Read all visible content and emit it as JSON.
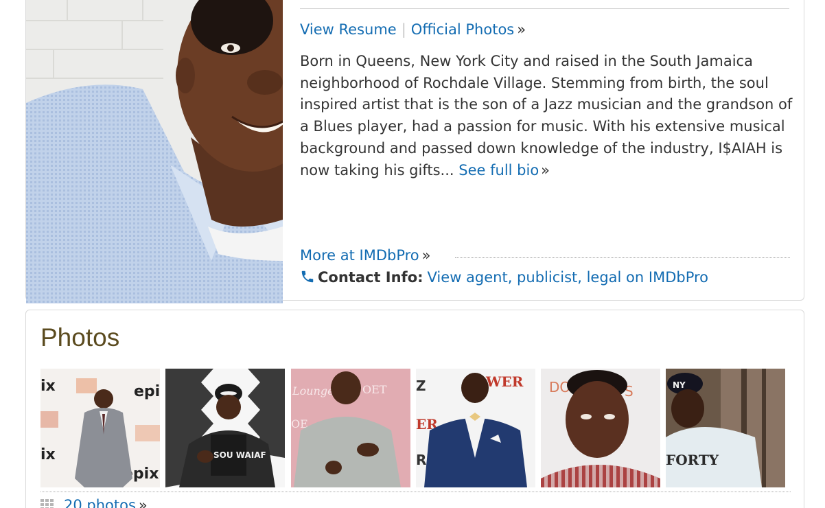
{
  "profile": {
    "view_resume": "View Resume",
    "separator": "|",
    "official_photos": "Official Photos",
    "raquo": "»",
    "bio_text": "Born in Queens, New York City and raised in the South Jamaica neighborhood of Rochdale Village. Stemming from birth, the soul inspired artist that is the son of a Jazz musician and the grandson of a Blues player, had a passion for music. With his extensive musical background and passed down knowledge of the industry, I$AIAH is now taking his gifts...",
    "see_full_bio": "See full bio",
    "more_at_imdbpro": "More at IMDbPro",
    "contact_label": "Contact Info:",
    "contact_link": "View agent, publicist, legal on IMDbPro"
  },
  "photos": {
    "heading": "Photos",
    "count_link": "20 photos",
    "raquo": "»",
    "thumbnails": [
      {
        "name": "photo-1",
        "backdrop_text": [
          "ix",
          "epi",
          "ix",
          "epix"
        ]
      },
      {
        "name": "photo-2",
        "shirt_text": "SOU WAIAF"
      },
      {
        "name": "photo-3",
        "backdrop_text": [
          "Lounge",
          "OET",
          "OE"
        ]
      },
      {
        "name": "photo-4",
        "backdrop_text": [
          "Z",
          "WER",
          "ER",
          "RZ"
        ]
      },
      {
        "name": "photo-5",
        "backdrop_text": [
          "DO",
          "S"
        ]
      },
      {
        "name": "photo-6",
        "cap_text": "NY",
        "shirt_text": "FORTY"
      }
    ]
  },
  "colors": {
    "link": "#136cb2",
    "heading": "#5b4b1f",
    "border": "#d9d9d9",
    "text": "#333333"
  },
  "icons": [
    "phone-icon",
    "grid-icon"
  ]
}
